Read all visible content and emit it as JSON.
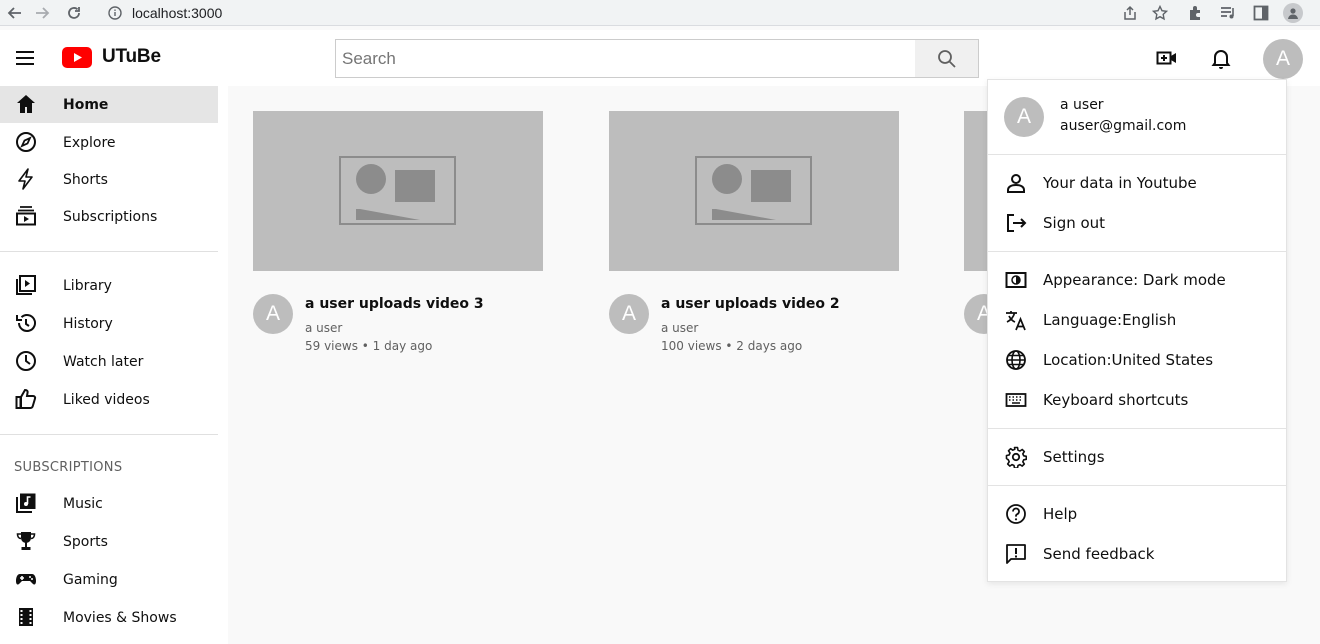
{
  "browser": {
    "url": "localhost:3000"
  },
  "header": {
    "logo_text": "UTuBe",
    "search_placeholder": "Search",
    "avatar_letter": "A"
  },
  "sidebar": {
    "items": [
      {
        "label": "Home",
        "icon": "home-icon"
      },
      {
        "label": "Explore",
        "icon": "compass-icon"
      },
      {
        "label": "Shorts",
        "icon": "bolt-icon"
      },
      {
        "label": "Subscriptions",
        "icon": "subscriptions-icon"
      },
      {
        "label": "Library",
        "icon": "library-icon"
      },
      {
        "label": "History",
        "icon": "history-icon"
      },
      {
        "label": "Watch later",
        "icon": "clock-icon"
      },
      {
        "label": "Liked videos",
        "icon": "thumbs-up-icon"
      },
      {
        "label": "Music",
        "icon": "music-icon"
      },
      {
        "label": "Sports",
        "icon": "trophy-icon"
      },
      {
        "label": "Gaming",
        "icon": "gamepad-icon"
      },
      {
        "label": "Movies & Shows",
        "icon": "film-icon"
      }
    ],
    "subscriptions_title": "SUBSCRIPTIONS"
  },
  "videos": [
    {
      "title": "a user uploads video 3",
      "channel": "a user",
      "stats": "59 views • 1 day ago",
      "avatar_letter": "A"
    },
    {
      "title": "a user uploads video 2",
      "channel": "a user",
      "stats": "100 views • 2 days ago",
      "avatar_letter": "A"
    },
    {
      "title": "",
      "channel": "",
      "stats": "",
      "avatar_letter": "A"
    }
  ],
  "account_menu": {
    "avatar_letter": "A",
    "name": "a user",
    "email": "auser@gmail.com",
    "items": [
      {
        "label": "Your data in Youtube",
        "icon": "person-icon"
      },
      {
        "label": "Sign out",
        "icon": "sign-out-icon"
      },
      {
        "label": "Appearance: Dark mode",
        "icon": "appearance-icon"
      },
      {
        "label": "Language:English",
        "icon": "translate-icon"
      },
      {
        "label": "Location:United States",
        "icon": "globe-icon"
      },
      {
        "label": "Keyboard shortcuts",
        "icon": "keyboard-icon"
      },
      {
        "label": "Settings",
        "icon": "gear-icon"
      },
      {
        "label": "Help",
        "icon": "help-icon"
      },
      {
        "label": "Send feedback",
        "icon": "feedback-icon"
      }
    ]
  },
  "colors": {
    "brand_red": "#ff0000",
    "placeholder_gray": "#bdbdbd",
    "active_bg": "#e5e5e5"
  }
}
